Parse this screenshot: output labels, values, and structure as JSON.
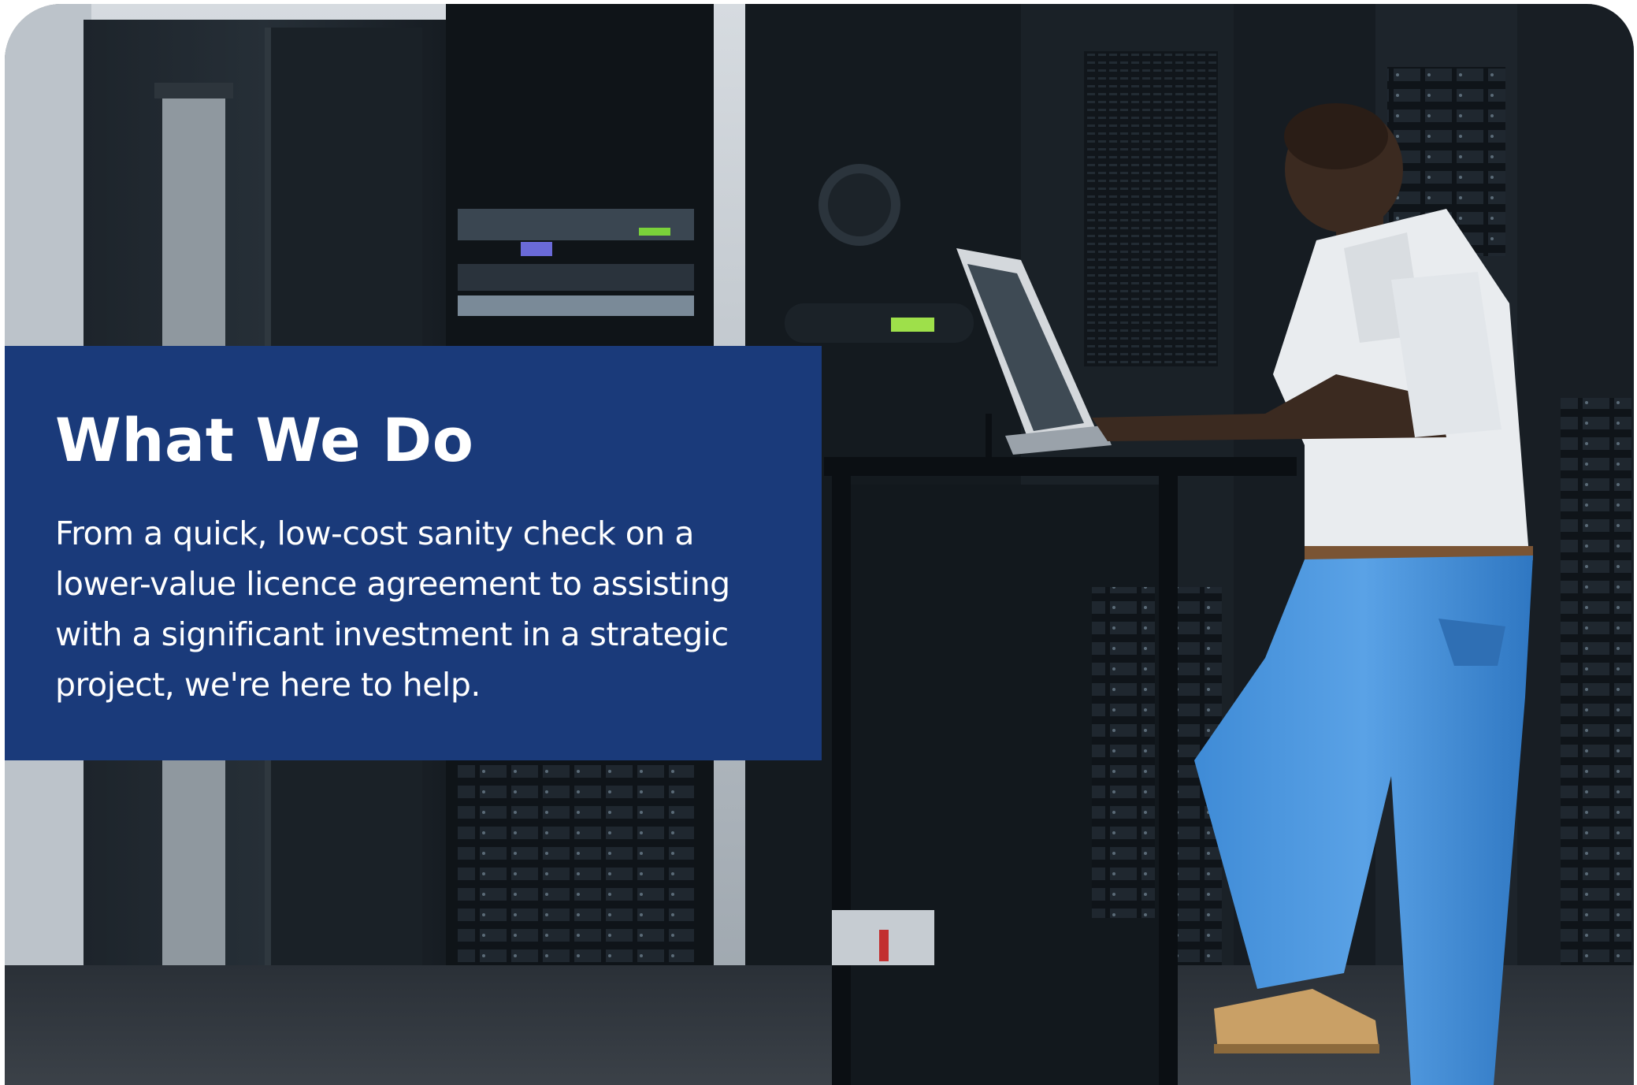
{
  "section": {
    "title": "What We Do",
    "body": "From a quick, low-cost sanity check on a lower-value licence agreement to assisting with a significant investment in a strategic project, we're here to help."
  },
  "colors": {
    "panel_background": "#1a3a7a",
    "panel_text": "#ffffff"
  },
  "image": {
    "subject": "technician-using-laptop-in-server-room"
  }
}
